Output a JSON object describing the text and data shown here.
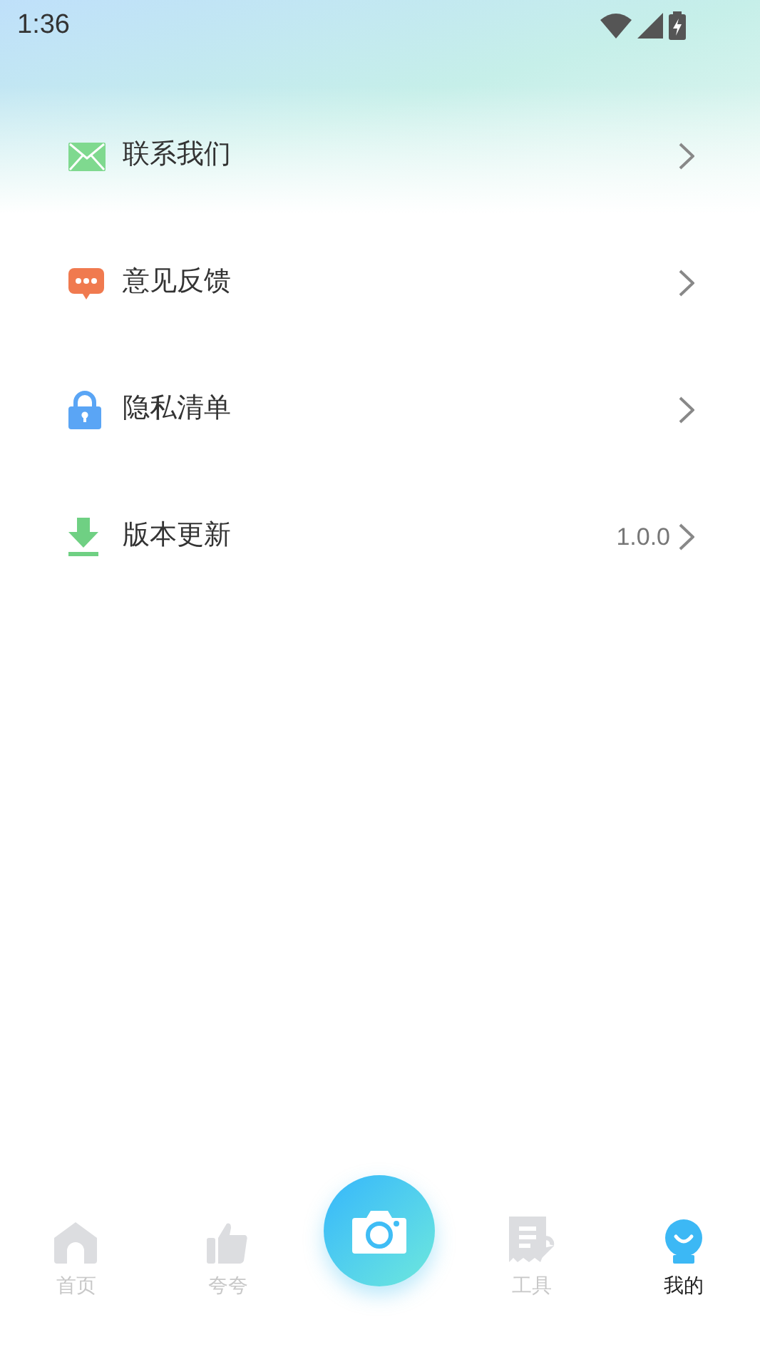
{
  "status_bar": {
    "time": "1:36"
  },
  "menu": [
    {
      "kind": "mail",
      "label": "联系我们"
    },
    {
      "kind": "chat",
      "label": "意见反馈"
    },
    {
      "kind": "lock",
      "label": "隐私清单"
    },
    {
      "kind": "download",
      "label": "版本更新",
      "value": "1.0.0"
    }
  ],
  "tabs": [
    {
      "kind": "home",
      "label": "首页",
      "selected": false
    },
    {
      "kind": "thumb",
      "label": "夸夸",
      "selected": false
    },
    {
      "kind": "camera"
    },
    {
      "kind": "tools",
      "label": "工具",
      "selected": false
    },
    {
      "kind": "me",
      "label": "我的",
      "selected": true
    }
  ]
}
